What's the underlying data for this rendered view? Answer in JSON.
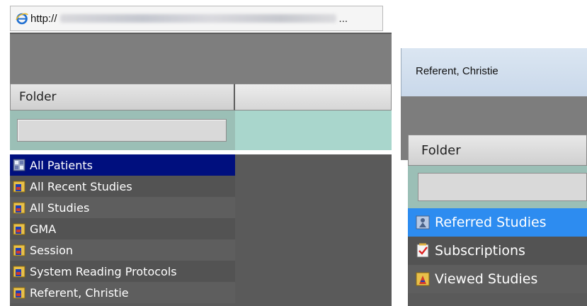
{
  "left_window": {
    "url_scheme": "http://",
    "url_suffix": "...",
    "folder_column_header": "Folder",
    "filter_placeholder": "",
    "items": [
      {
        "label": "All Patients",
        "icon": "all-patients-icon",
        "selected": true
      },
      {
        "label": "All Recent Studies",
        "icon": "folder-icon",
        "selected": false
      },
      {
        "label": "All Studies",
        "icon": "folder-icon",
        "selected": false
      },
      {
        "label": "GMA",
        "icon": "folder-icon",
        "selected": false
      },
      {
        "label": "Session",
        "icon": "folder-icon",
        "selected": false
      },
      {
        "label": "System Reading Protocols",
        "icon": "folder-icon",
        "selected": false
      },
      {
        "label": "Referent, Christie",
        "icon": "folder-icon",
        "selected": false
      }
    ]
  },
  "right_window": {
    "title": "Referent, Christie",
    "folder_column_header": "Folder",
    "filter_placeholder": "",
    "items": [
      {
        "label": "Referred Studies",
        "icon": "referred-studies-icon",
        "selected": true
      },
      {
        "label": "Subscriptions",
        "icon": "subscriptions-icon",
        "selected": false
      },
      {
        "label": "Viewed Studies",
        "icon": "viewed-studies-icon",
        "selected": false
      }
    ]
  },
  "colors": {
    "selected_row_left": "#000f7e",
    "selected_row_right": "#2d8cf0",
    "filter_row": "#9bbfb6",
    "list_background": "#5a5a5a",
    "header_band": "#7e7e7e"
  }
}
